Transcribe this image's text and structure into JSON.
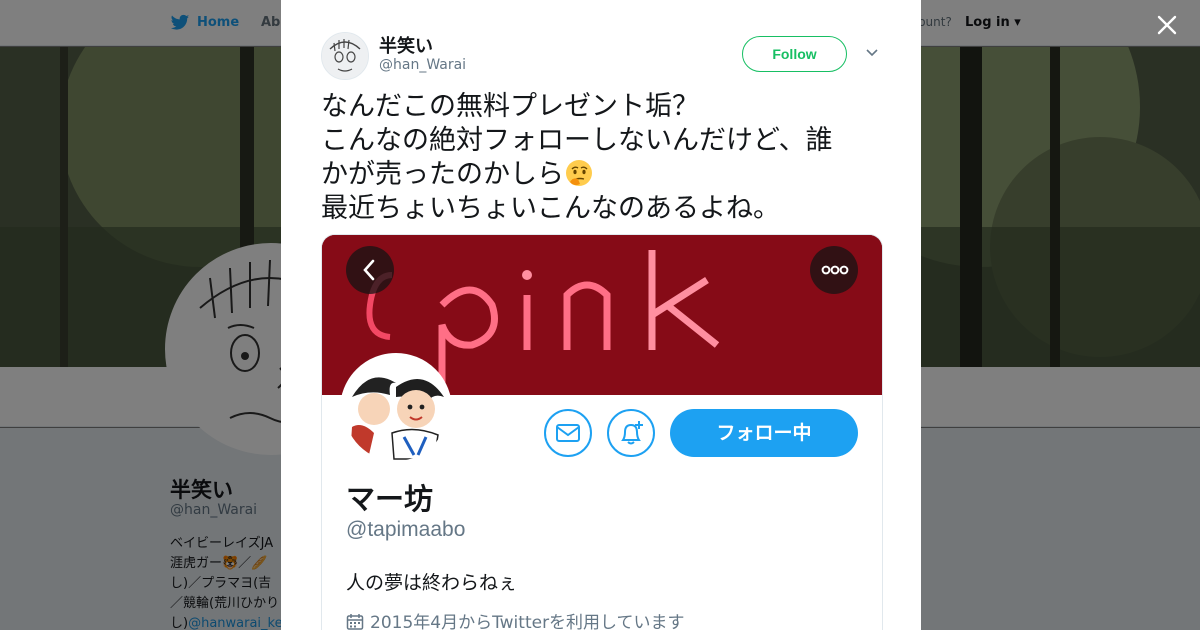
{
  "background_page": {
    "nav": {
      "home_label": "Home",
      "about_label": "Abo",
      "account_prompt": "ccount?",
      "login_label": "Log in"
    },
    "profile": {
      "name": "半笑い",
      "handle": "@han_Warai",
      "bio_lines": [
        "ベイビーレイズJA",
        "涯虎ガー🐯／🥖",
        "し)／プラマヨ(吉",
        "／競輪(荒川ひかり",
        "し)"
      ],
      "bio_link": "@hanwarai_ke"
    }
  },
  "modal": {
    "user": {
      "name": "半笑い",
      "handle": "@han_Warai"
    },
    "follow_label": "Follow",
    "tweet_lines": [
      "なんだこの無料プレゼント垢？",
      "こんなの絶対フォローしないんだけど、誰",
      "かが売ったのかしら",
      "最近ちょいちょいこんなのあるよね。"
    ],
    "tweet_emoji": "thinking-face",
    "media": {
      "banner_text": "pink",
      "profile_name": "マー坊",
      "profile_handle": "@tapimaabo",
      "following_label": "フォロー中",
      "bio": "人の夢は終わらねぇ",
      "joined": "2015年4月からTwitterを利用しています"
    }
  },
  "icons": {
    "close": "close-icon",
    "twitter": "twitter-bird-icon",
    "caret": "chevron-down-icon",
    "calendar": "calendar-icon"
  },
  "colors": {
    "twitter_blue": "#1da1f2",
    "follow_green": "#17bf63",
    "banner_red": "#7a0a12"
  }
}
